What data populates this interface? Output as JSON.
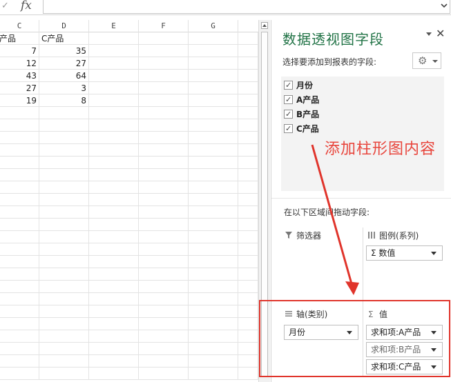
{
  "formula_bar": {
    "check_icon": "check-icon",
    "fx_label": "fx",
    "value": ""
  },
  "sheet": {
    "columns": [
      {
        "letter": "C"
      },
      {
        "letter": "D"
      },
      {
        "letter": "E"
      },
      {
        "letter": "F"
      },
      {
        "letter": "G"
      }
    ],
    "header_row": [
      "产品",
      "C产品"
    ],
    "rows": [
      [
        "7",
        "35"
      ],
      [
        "12",
        "27"
      ],
      [
        "43",
        "64"
      ],
      [
        "27",
        "3"
      ],
      [
        "19",
        "8"
      ]
    ]
  },
  "pivot_pane": {
    "title": "数据透视图字段",
    "choose_label": "选择要添加到报表的字段:",
    "fields": [
      {
        "label": "月份",
        "checked": true
      },
      {
        "label": "A产品",
        "checked": true
      },
      {
        "label": "B产品",
        "checked": true
      },
      {
        "label": "C产品",
        "checked": true
      }
    ],
    "drag_label": "在以下区域间拖动字段:",
    "areas": {
      "filter": {
        "title": "筛选器",
        "icon": "filter-icon"
      },
      "legend": {
        "title": "图例(系列)",
        "icon": "columns-icon",
        "items": [
          "Σ 数值"
        ]
      },
      "axis": {
        "title": "轴(类别)",
        "icon": "rows-icon",
        "items": [
          "月份"
        ]
      },
      "values": {
        "title": "值",
        "icon": "sigma-icon",
        "items": [
          "求和项:A产品",
          "求和项:B产品",
          "求和项:C产品"
        ]
      }
    }
  },
  "annotation": {
    "text": "添加柱形图内容",
    "color": "#e8453c"
  },
  "colors": {
    "pane_title": "#217346",
    "highlight_box": "#e0342b"
  }
}
